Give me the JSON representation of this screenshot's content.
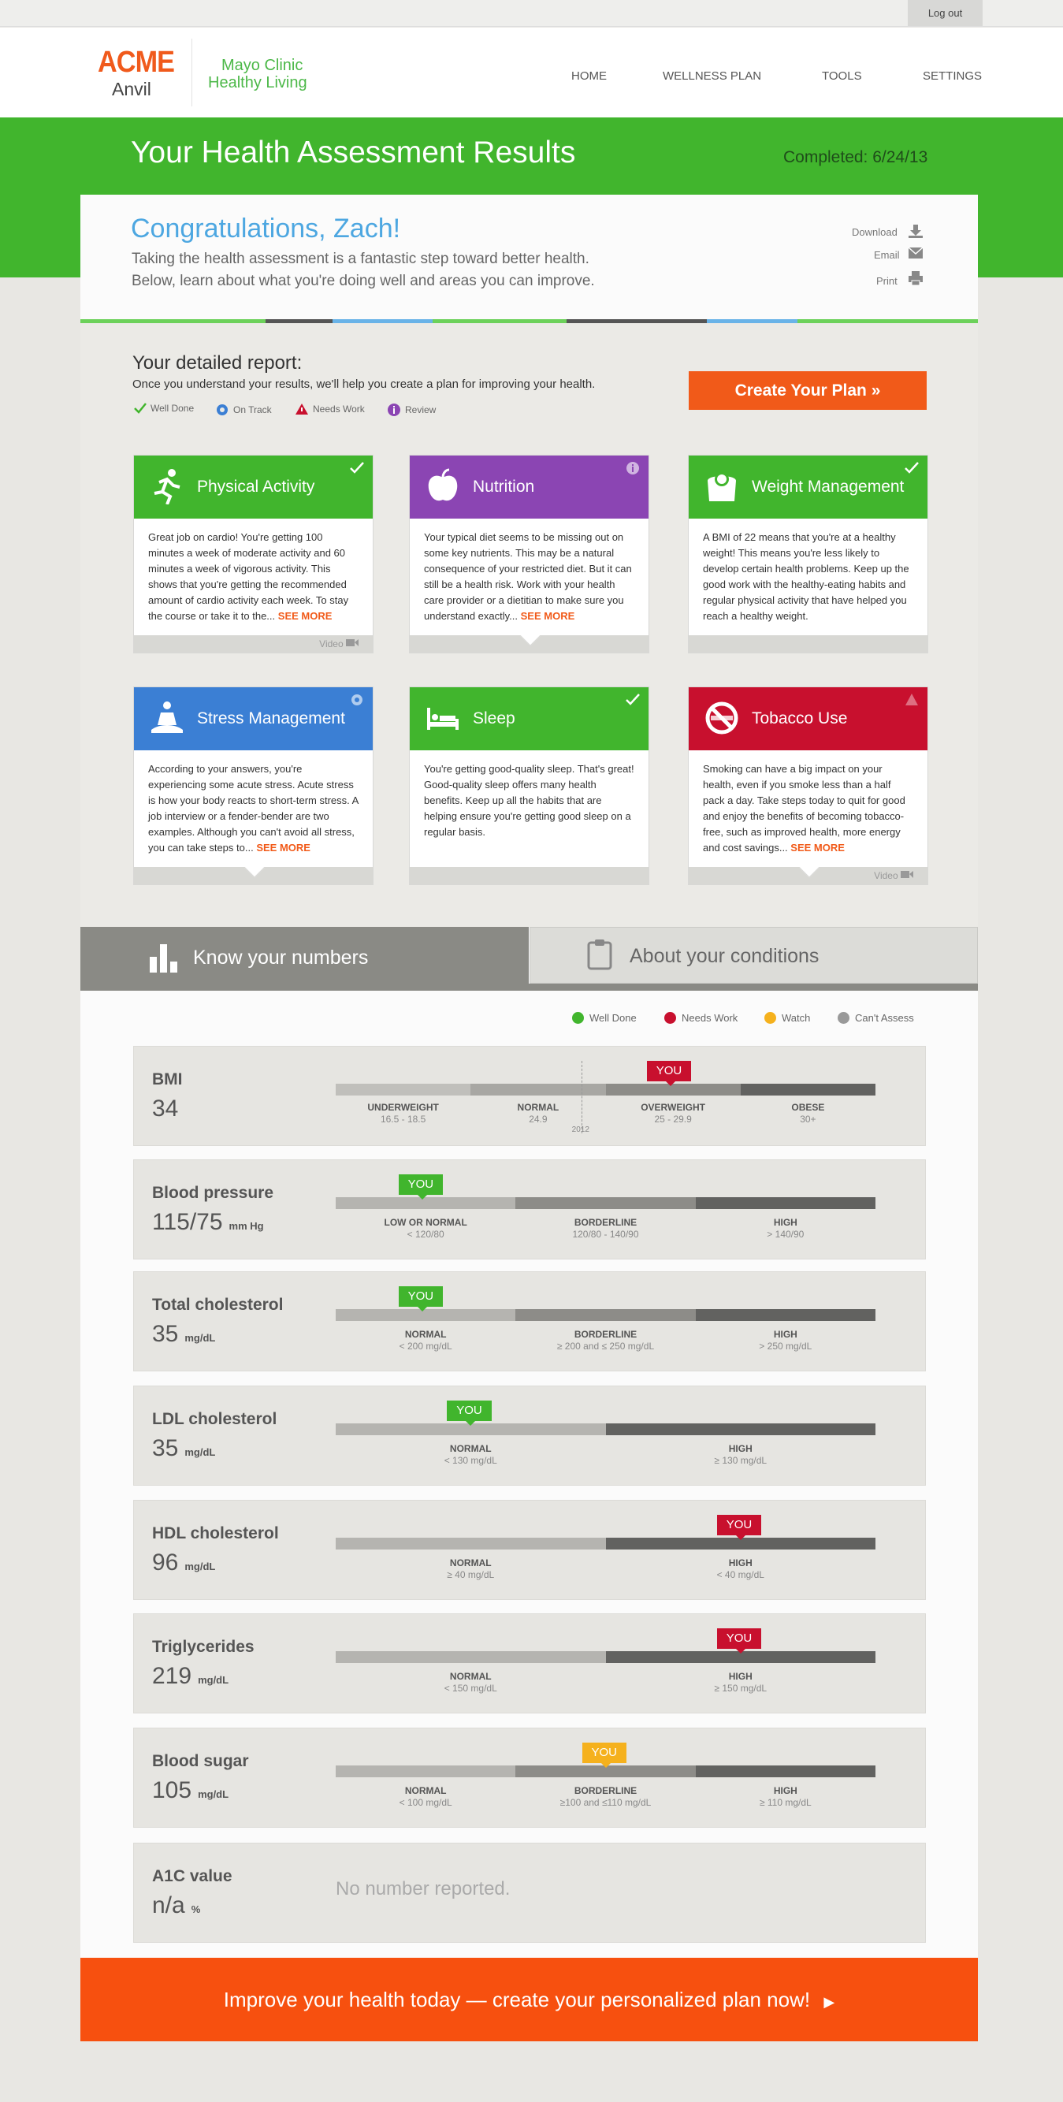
{
  "topbar": {
    "logout": "Log out"
  },
  "brand": {
    "acme": "ACME",
    "anvil": "Anvil",
    "partner_line1": "Mayo Clinic",
    "partner_line2": "Healthy Living"
  },
  "nav": [
    "HOME",
    "WELLNESS PLAN",
    "TOOLS",
    "SETTINGS"
  ],
  "page": {
    "title": "Your Health Assessment Results",
    "completed": "Completed: 6/24/13"
  },
  "greeting": {
    "title": "Congratulations, Zach!",
    "line1": "Taking the health assessment is a fantastic step toward better health.",
    "line2": "Below, learn about what you're doing well and areas you can improve."
  },
  "actions": {
    "download": "Download",
    "email": "Email",
    "print": "Print"
  },
  "report": {
    "title": "Your detailed report:",
    "subtitle": "Once you understand your results, we'll help you create a plan for improving your health.",
    "legend": [
      "Well Done",
      "On Track",
      "Needs Work",
      "Review"
    ],
    "cta": "Create Your Plan »"
  },
  "cards": [
    {
      "title": "Physical Activity",
      "color": "#41b52d",
      "status": "well-done",
      "text": "Great job on cardio! You're getting 100 minutes a week of moderate activity and 60 minutes a week of vigorous activity. This shows that you're getting the recommended amount of cardio activity each week. To stay the course or take it to the...",
      "more": "SEE MORE",
      "footer": "Video"
    },
    {
      "title": "Nutrition",
      "color": "#8b45b3",
      "status": "review",
      "text": "Your typical diet seems to be missing out on some key nutrients. This may be a natural consequence of your restricted diet. But it can still be a health risk. Work with your health care provider or a dietitian to make sure you understand exactly...",
      "more": "SEE MORE",
      "footer": ""
    },
    {
      "title": "Weight Management",
      "color": "#41b52d",
      "status": "well-done",
      "text": "A BMI of 22 means that you're at a healthy weight! This means you're less likely to develop certain health problems. Keep up the good work with the healthy-eating habits and regular physical activity that have helped you reach a healthy weight.",
      "more": "",
      "footer": ""
    },
    {
      "title": "Stress Management",
      "color": "#3b7fd4",
      "status": "on-track",
      "text": "According to your answers, you're experiencing some acute stress. Acute stress is how your body reacts to short-term stress. A job interview or a fender-bender are two examples. Although you can't avoid all stress, you can take steps to...",
      "more": "SEE MORE",
      "footer": ""
    },
    {
      "title": "Sleep",
      "color": "#41b52d",
      "status": "well-done",
      "text": "You're getting good-quality sleep. That's great! Good-quality sleep offers many health benefits. Keep up all the habits that are helping ensure you're getting good sleep on a regular basis.",
      "more": "",
      "footer": ""
    },
    {
      "title": "Tobacco Use",
      "color": "#c8102e",
      "status": "needs-work",
      "text": "Smoking can have a big impact on your health, even if you smoke less than a half pack a day. Take steps today to quit for good and enjoy the benefits of becoming tobacco-free, such as improved health, more energy and cost savings...",
      "more": "SEE MORE",
      "footer": "Video"
    }
  ],
  "tabs": {
    "numbers": "Know your numbers",
    "conditions": "About your conditions"
  },
  "numbers_legend": [
    {
      "label": "Well Done",
      "color": "#41b52d"
    },
    {
      "label": "Needs Work",
      "color": "#c8102e"
    },
    {
      "label": "Watch",
      "color": "#f5b11d"
    },
    {
      "label": "Can't Assess",
      "color": "#999999"
    }
  ],
  "metrics": [
    {
      "name": "BMI",
      "value": "34",
      "unit": "",
      "you_label": "YOU",
      "you_color": "#c8102e",
      "year_marker": "2012",
      "ranges": [
        {
          "label": "UNDERWEIGHT",
          "sub": "16.5 - 18.5"
        },
        {
          "label": "NORMAL",
          "sub": "24.9"
        },
        {
          "label": "OVERWEIGHT",
          "sub": "25 - 29.9"
        },
        {
          "label": "OBESE",
          "sub": "30+"
        }
      ]
    },
    {
      "name": "Blood pressure",
      "value": "115/75",
      "unit": "mm Hg",
      "you_label": "YOU",
      "you_color": "#41b52d",
      "ranges": [
        {
          "label": "LOW OR NORMAL",
          "sub": "< 120/80"
        },
        {
          "label": "BORDERLINE",
          "sub": "120/80 - 140/90"
        },
        {
          "label": "HIGH",
          "sub": "> 140/90"
        }
      ]
    },
    {
      "name": "Total cholesterol",
      "value": "35",
      "unit": "mg/dL",
      "you_label": "YOU",
      "you_color": "#41b52d",
      "ranges": [
        {
          "label": "NORMAL",
          "sub": "<  200 mg/dL"
        },
        {
          "label": "BORDERLINE",
          "sub": "≥ 200 and ≤ 250 mg/dL"
        },
        {
          "label": "HIGH",
          "sub": "> 250 mg/dL"
        }
      ]
    },
    {
      "name": "LDL cholesterol",
      "value": "35",
      "unit": "mg/dL",
      "you_label": "YOU",
      "you_color": "#41b52d",
      "ranges": [
        {
          "label": "NORMAL",
          "sub": "<  130 mg/dL"
        },
        {
          "label": "HIGH",
          "sub": "≥ 130 mg/dL"
        }
      ]
    },
    {
      "name": "HDL cholesterol",
      "value": "96",
      "unit": "mg/dL",
      "you_label": "YOU",
      "you_color": "#c8102e",
      "ranges": [
        {
          "label": "NORMAL",
          "sub": "≥ 40 mg/dL"
        },
        {
          "label": "HIGH",
          "sub": "<  40 mg/dL"
        }
      ]
    },
    {
      "name": "Triglycerides",
      "value": "219",
      "unit": "mg/dL",
      "you_label": "YOU",
      "you_color": "#c8102e",
      "ranges": [
        {
          "label": "NORMAL",
          "sub": "<  150 mg/dL"
        },
        {
          "label": "HIGH",
          "sub": "≥ 150 mg/dL"
        }
      ]
    },
    {
      "name": "Blood sugar",
      "value": "105",
      "unit": "mg/dL",
      "you_label": "YOU",
      "you_color": "#f5b11d",
      "ranges": [
        {
          "label": "NORMAL",
          "sub": "<  100 mg/dL"
        },
        {
          "label": "BORDERLINE",
          "sub": "≥100 and ≤110 mg/dL"
        },
        {
          "label": "HIGH",
          "sub": "≥ 110 mg/dL"
        }
      ]
    },
    {
      "name": "A1C value",
      "value": "n/a",
      "unit": "%",
      "empty_text": "No number reported."
    }
  ],
  "footer_cta": "Improve your health today — create your personalized plan now!"
}
